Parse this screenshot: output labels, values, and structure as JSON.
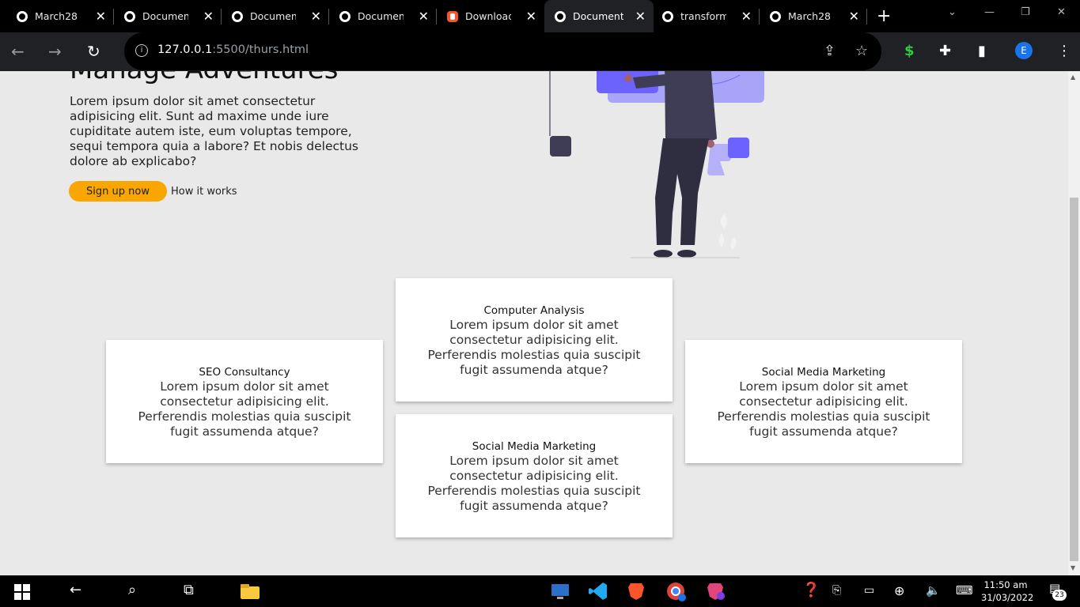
{
  "browser": {
    "tabs": [
      {
        "title": "March28",
        "icon": "globe-icon"
      },
      {
        "title": "Document",
        "icon": "globe-icon"
      },
      {
        "title": "Document",
        "icon": "globe-icon"
      },
      {
        "title": "Document",
        "icon": "globe-icon"
      },
      {
        "title": "Download I",
        "icon": "brave-icon"
      },
      {
        "title": "Document",
        "icon": "globe-icon",
        "active": true
      },
      {
        "title": "transform t",
        "icon": "globe-icon"
      },
      {
        "title": "March28",
        "icon": "globe-icon"
      }
    ],
    "url_host": "127.0.0.1",
    "url_rest": ":5500/thurs.html",
    "profile_initial": "E"
  },
  "hero": {
    "title": "Manage Adventures",
    "text": "Lorem ipsum dolor sit amet consectetur adipisicing elit. Sunt ad maxime unde iure cupiditate autem iste, eum voluptas tempore, sequi tempora quia a labore? Et nobis delectus dolore ab explicabo?",
    "signup_label": "Sign up now",
    "how_label": "How it works",
    "accent": "#f9a602"
  },
  "cards": [
    {
      "title": "Computer Analysis",
      "text": "Lorem ipsum dolor sit amet consectetur adipisicing elit. Perferendis molestias quia suscipit fugit assumenda atque?"
    },
    {
      "title": "SEO Consultancy",
      "text": "Lorem ipsum dolor sit amet consectetur adipisicing elit. Perferendis molestias quia suscipit fugit assumenda atque?"
    },
    {
      "title": "Social Media Marketing",
      "text": "Lorem ipsum dolor sit amet consectetur adipisicing elit. Perferendis molestias quia suscipit fugit assumenda atque?"
    },
    {
      "title": "Social Media Marketing",
      "text": "Lorem ipsum dolor sit amet consectetur adipisicing elit. Perferendis molestias quia suscipit fugit assumenda atque?"
    }
  ],
  "taskbar": {
    "time": "11:50 am",
    "date": "31/03/2022",
    "notifications": "23"
  },
  "colors": {
    "illustration_purple": "#6c63ff",
    "illustration_dark": "#3f3d56"
  }
}
